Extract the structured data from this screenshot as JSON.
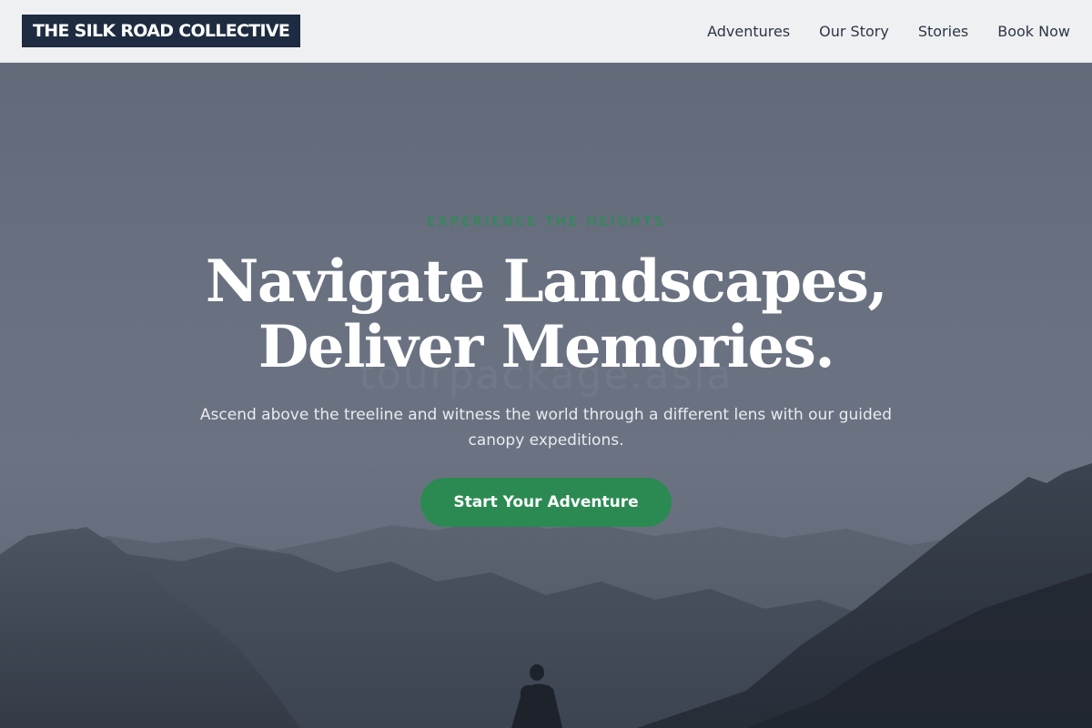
{
  "header": {
    "logo_text": "THE SILK ROAD COLLECTIVE",
    "nav": [
      {
        "label": "Adventures"
      },
      {
        "label": "Our Story"
      },
      {
        "label": "Stories"
      },
      {
        "label": "Book Now"
      }
    ]
  },
  "hero": {
    "eyebrow": "EXPERIENCE THE HEIGHTS",
    "headline_line1": "Navigate Landscapes,",
    "headline_line2": "Deliver Memories.",
    "subtext": "Ascend above the treeline and witness the world through a different lens with our guided canopy expeditions.",
    "cta_label": "Start Your Adventure",
    "watermark": "tourpackage.asia"
  },
  "colors": {
    "logo_bg": "#1e2b40",
    "nav_bg": "#eff0f1",
    "accent_green": "#2b8a52",
    "nav_text": "#2b3647"
  }
}
